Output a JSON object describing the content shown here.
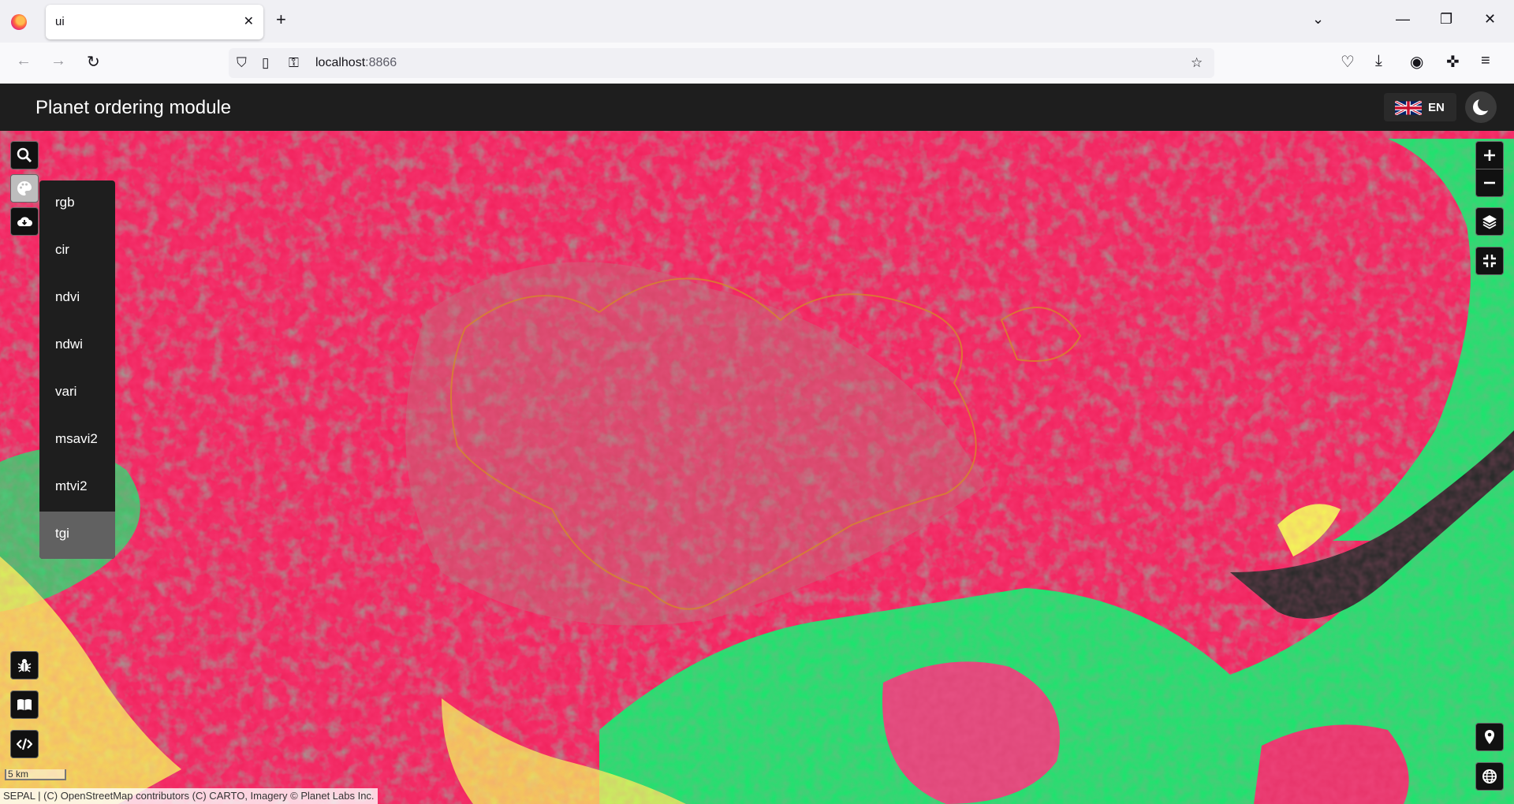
{
  "browser": {
    "tab_title": "ui",
    "url_host": "localhost",
    "url_port": ":8866"
  },
  "app": {
    "title": "Planet ordering module",
    "language": "EN"
  },
  "map": {
    "visualization_menu": [
      "rgb",
      "cir",
      "ndvi",
      "ndwi",
      "vari",
      "msavi2",
      "mtvi2",
      "tgi"
    ],
    "selected_visualization": "tgi",
    "scale_label": "5 km",
    "attribution": "SEPAL | (C) OpenStreetMap contributors (C) CARTO, Imagery © Planet Labs Inc."
  },
  "colors": {
    "red": "#f2245f",
    "green": "#1ee36e",
    "yellow": "#f3f15a",
    "header": "#1e1e1e"
  }
}
